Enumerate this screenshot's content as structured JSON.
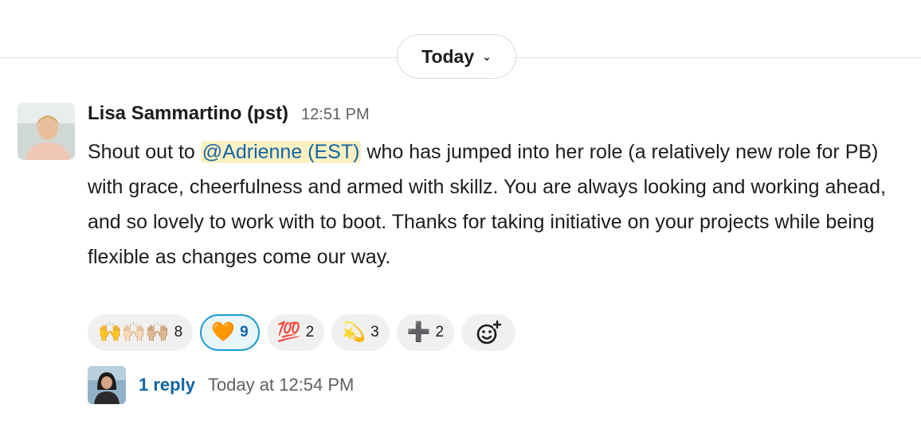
{
  "date_divider": {
    "label": "Today",
    "chevron": "⌄"
  },
  "message": {
    "sender": "Lisa Sammartino (pst)",
    "time": "12:51 PM",
    "text_before_mention": "Shout out to ",
    "mention": "@Adrienne (EST)",
    "text_after_mention": " who has jumped into her role (a relatively new role for PB) with grace, cheerfulness and armed with skillz. You are always looking and working ahead, and so lovely to work with to boot. Thanks for taking initiative on your projects while being flexible as changes come our way."
  },
  "reactions": [
    {
      "emoji": "🙌🙌🏻🙌🏼",
      "icon": "raised-hands-icon",
      "count": "8",
      "active": false
    },
    {
      "emoji": "🧡",
      "icon": "orange-heart-icon",
      "count": "9",
      "active": true
    },
    {
      "emoji": "💯",
      "icon": "hundred-points-icon",
      "count": "2",
      "active": false
    },
    {
      "emoji": "💫",
      "icon": "dizzy-icon",
      "count": "3",
      "active": false
    },
    {
      "emoji": "➕",
      "icon": "plus-icon",
      "count": "2",
      "active": false
    }
  ],
  "thread": {
    "reply_count": "1 reply",
    "last_reply": "Today at 12:54 PM"
  },
  "colors": {
    "link": "#1264a3",
    "mention_bg": "#fdf1c3",
    "active_reaction_border": "#1d9bd1"
  }
}
